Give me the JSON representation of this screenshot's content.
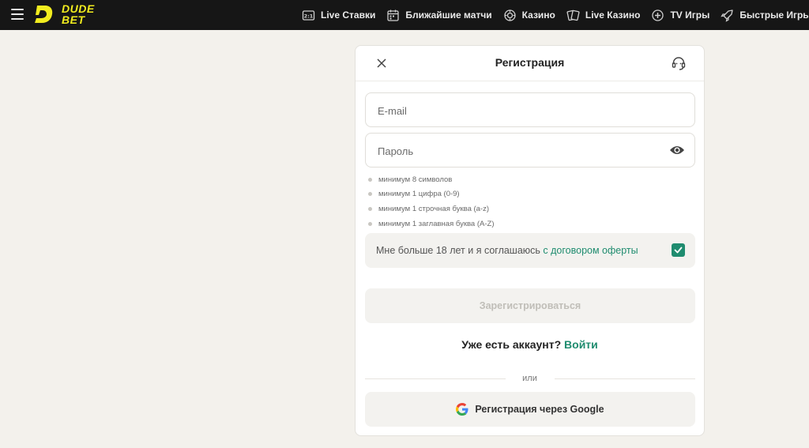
{
  "header": {
    "logo_text_line1": "DUDE",
    "logo_text_line2": "BET",
    "nav": [
      {
        "label": "Live Ставки",
        "icon": "live-bets-icon"
      },
      {
        "label": "Ближайшие матчи",
        "icon": "calendar-icon"
      },
      {
        "label": "Казино",
        "icon": "casino-chip-icon"
      },
      {
        "label": "Live Казино",
        "icon": "cards-icon"
      },
      {
        "label": "TV Игры",
        "icon": "tv-games-icon"
      },
      {
        "label": "Быстрые Игры",
        "icon": "rocket-icon"
      }
    ]
  },
  "registration": {
    "title": "Регистрация",
    "email_placeholder": "E-mail",
    "password_placeholder": "Пароль",
    "rules": [
      "минимум 8 символов",
      "минимум 1 цифра (0-9)",
      "минимум 1 строчная буква (a-z)",
      "минимум 1 заглавная буква (A-Z)"
    ],
    "agree_text": "Мне больше 18 лет и я соглашаюсь ",
    "agree_link": "с договором оферты",
    "agree_checked": true,
    "submit_label": "Зарегистрироваться",
    "have_account": "Уже есть аккаунт? ",
    "login_label": "Войти",
    "or_label": "или",
    "google_label": "Регистрация через Google"
  },
  "colors": {
    "accent": "#1f8c6f",
    "logo": "#f1ec1f",
    "topbar": "#161616",
    "background": "#f3f1ec"
  }
}
